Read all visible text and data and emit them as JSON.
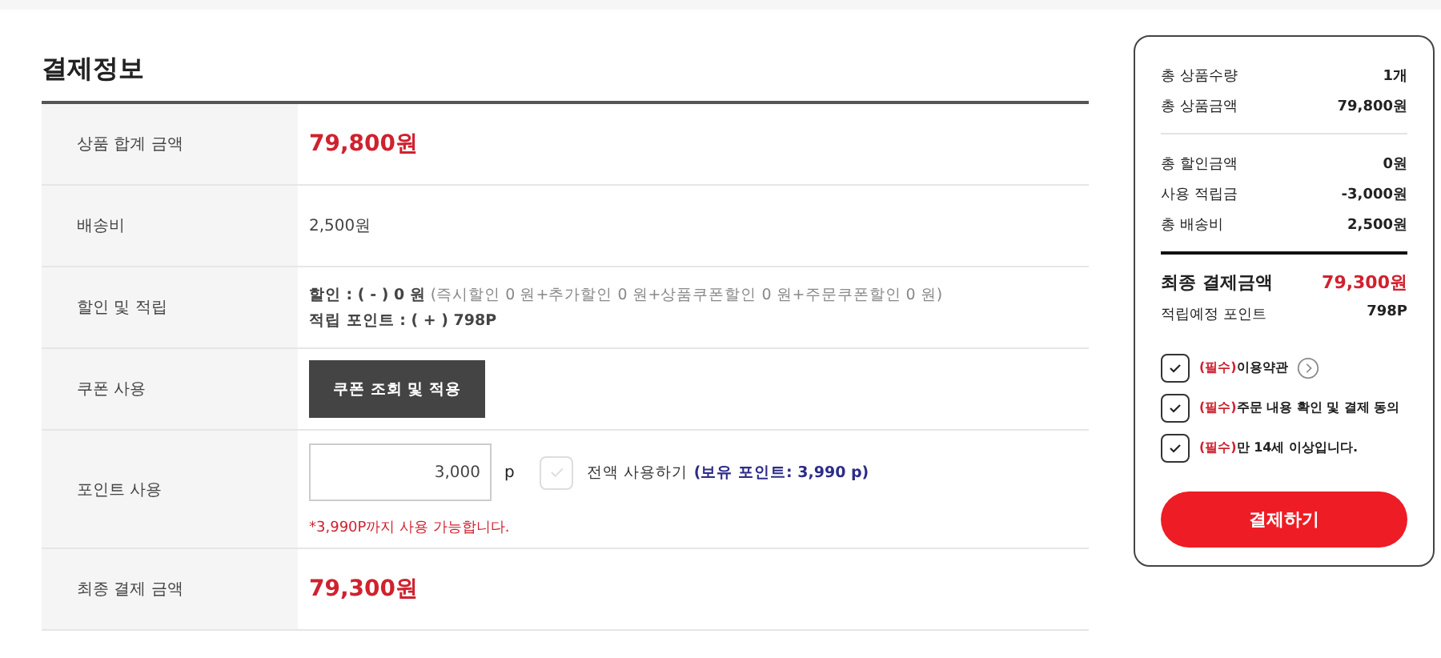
{
  "title": "결제정보",
  "rows": [
    {
      "kind": "price",
      "label": "상품 합계 금액",
      "value": "79,800원"
    },
    {
      "kind": "text",
      "label": "배송비",
      "value": "2,500원"
    },
    {
      "kind": "discount",
      "label": "할인 및 적립",
      "discount_label": "할인 : ( - ) 0 원",
      "discount_detail": "(즉시할인 0 원+추가할인 0 원+상품쿠폰할인 0 원+주문쿠폰할인 0 원)",
      "points": "적립 포인트 : ( + ) 798P"
    },
    {
      "kind": "coupon",
      "label": "쿠폰 사용",
      "button": "쿠폰 조회 및 적용"
    },
    {
      "kind": "points",
      "label": "포인트 사용",
      "value": "3,000",
      "unit": "p",
      "use_all": {
        "label": "전액 사용하기",
        "checked": false
      },
      "owned": "(보유 포인트: 3,990 p)",
      "notice": "*3,990P까지 사용 가능합니다."
    },
    {
      "kind": "price",
      "label": "최종 결제 금액",
      "value": "79,300원"
    }
  ],
  "summary": {
    "groups": [
      [
        {
          "label": "총 상품수량",
          "value": "1개"
        },
        {
          "label": "총 상품금액",
          "value": "79,800원"
        }
      ],
      [
        {
          "label": "총 할인금액",
          "value": "0원"
        },
        {
          "label": "사용 적립금",
          "value": "-3,000원"
        },
        {
          "label": "총 배송비",
          "value": "2,500원"
        }
      ]
    ],
    "final": {
      "label": "최종 결제금액",
      "value": "79,300원"
    },
    "points": {
      "label": "적립예정 포인트",
      "value": "798P"
    },
    "agreements": [
      {
        "prefix": "(필수)",
        "text": "이용약관",
        "checked": true,
        "has_link": true
      },
      {
        "prefix": "(필수)",
        "text": "주문 내용 확인 및 결제 동의",
        "checked": true,
        "has_link": false
      },
      {
        "prefix": "(필수)",
        "text": "만 14세 이상입니다.",
        "checked": true,
        "has_link": false
      }
    ],
    "pay_button": "결제하기"
  }
}
